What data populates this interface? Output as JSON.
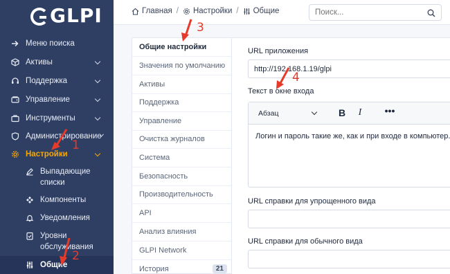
{
  "app": {
    "logo_text": "GLPI"
  },
  "sidebar": {
    "items": [
      {
        "label": "Меню поиска",
        "icon": "arrow-right-icon",
        "expandable": false
      },
      {
        "label": "Активы",
        "icon": "cube-icon",
        "expandable": true
      },
      {
        "label": "Поддержка",
        "icon": "headset-icon",
        "expandable": true
      },
      {
        "label": "Управление",
        "icon": "wallet-icon",
        "expandable": true
      },
      {
        "label": "Инструменты",
        "icon": "briefcase-icon",
        "expandable": true
      },
      {
        "label": "Администрирование",
        "icon": "shield-icon",
        "expandable": true
      },
      {
        "label": "Настройки",
        "icon": "gear-icon",
        "expandable": true,
        "active": true
      }
    ],
    "subitems": [
      {
        "label_line1": "Выпадающие",
        "label_line2": "списки",
        "icon": "edit-icon"
      },
      {
        "label_line1": "Компоненты",
        "label_line2": "",
        "icon": "puzzle-icon"
      },
      {
        "label_line1": "Уведомления",
        "label_line2": "",
        "icon": "bell-icon"
      },
      {
        "label_line1": "Уровни",
        "label_line2": "обслуживания",
        "icon": "checklist-icon"
      },
      {
        "label_line1": "Общие",
        "label_line2": "",
        "icon": "sliders-icon",
        "current": true
      }
    ],
    "active_color": "#f7a800",
    "background": "#2f3f64"
  },
  "header": {
    "breadcrumbs": [
      {
        "label": "Главная",
        "icon": "home-icon"
      },
      {
        "label": "Настройки",
        "icon": "gear-icon"
      },
      {
        "label": "Общие",
        "icon": "sliders-icon"
      }
    ],
    "search": {
      "placeholder": "Поиск...",
      "value": ""
    }
  },
  "tabs": [
    {
      "label": "Общие настройки",
      "selected": true
    },
    {
      "label": "Значения по умолчанию"
    },
    {
      "label": "Активы"
    },
    {
      "label": "Поддержка"
    },
    {
      "label": "Управление"
    },
    {
      "label": "Очистка журналов"
    },
    {
      "label": "Система"
    },
    {
      "label": "Безопасность"
    },
    {
      "label": "Производительность"
    },
    {
      "label": "API"
    },
    {
      "label": "Анализ влияния"
    },
    {
      "label": "GLPI Network"
    },
    {
      "label": "История",
      "badge": "21"
    }
  ],
  "form": {
    "app_url_label": "URL приложения",
    "app_url_value": "http://192.168.1.19/glpi",
    "login_text_label": "Текст в окне входа",
    "editor": {
      "paragraph_select": "Абзац",
      "bold": "B",
      "italic": "I",
      "more": "•••",
      "content": "Логин и пароль такие же, как и при входе в компьютер."
    },
    "simplified_help_label": "URL справки для упрощенного вида",
    "simplified_help_value": "",
    "standard_help_label": "URL справки для обычного вида",
    "standard_help_value": ""
  },
  "annotations": {
    "color": "#e63a2a",
    "marks": [
      "1",
      "2",
      "3",
      "4"
    ]
  }
}
